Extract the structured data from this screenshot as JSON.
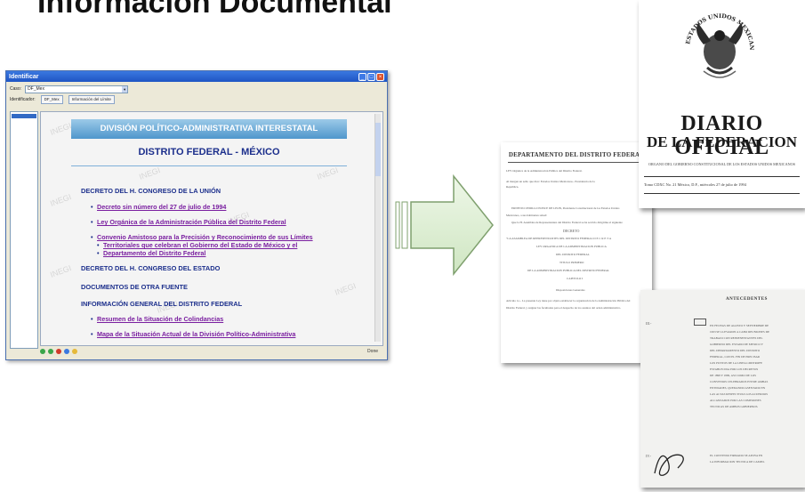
{
  "slide": {
    "title": "Información Documental"
  },
  "window": {
    "title": "Identificar",
    "caso_label": "Caso:",
    "caso_value": "DF_Mex",
    "identificador_label": "Identificador:",
    "tab1": "DF_Mex",
    "tab2": "Información del Límite",
    "status": "Done"
  },
  "page": {
    "banner_title": "DIVISIÓN POLÍTICO-ADMINISTRATIVA INTERESTATAL",
    "subtitle": "DISTRITO FEDERAL - MÉXICO",
    "sections": [
      "DECRETO DEL H. CONGRESO DE LA UNIÓN",
      "DECRETO DEL H. CONGRESO DEL ESTADO",
      "DOCUMENTOS DE OTRA FUENTE",
      "INFORMACIÓN GENERAL DEL DISTRITO FEDERAL"
    ],
    "links": [
      "Decreto sin número del 27 de julio de 1994",
      "Ley Orgánica de la Administración Pública del Distrito Federal",
      "Convenio Amistoso para la Precisión y Reconocimiento de sus Límites",
      "Territoriales que celebran el Gobierno del Estado de México y el",
      "Departamento del Distrito Federal",
      "Resumen de la Situación de Colindancias",
      "Mapa de la Situación Actual de la División Político-Administrativa"
    ],
    "watermark": "INEGI"
  },
  "docs": {
    "doc1_title": "DEPARTAMENTO DEL DISTRITO FEDERAL",
    "doc1_lines": [
      "LEY Orgánica de la Administración Pública del Distrito Federal.",
      "Al margen un sello que dice: Estados Unidos Mexicanos.- Presidencia de la",
      "República.",
      "ERNESTO ZEDILLO PONCE DE LEON, Presidente Constitucional de los Estados Unidos",
      "Mexicanos, a sus habitantes sabed:",
      "Que la H. Asamblea de Representantes del Distrito Federal se ha servido dirigirme el siguiente",
      "DECRETO",
      "\"LA ASAMBLEA DE REPRESENTANTES DEL DISTRITO FEDERAL D E C R E T A",
      "LEY ORGANICA DE LA ADMINISTRACION PUBLICA",
      "DEL DISTRITO FEDERAL",
      "TITULO PRIMERO",
      "DE LA ADMINISTRACION PUBLICA DEL DISTRITO FEDERAL",
      "CAPITULO I",
      "Disposiciones Generales",
      "Artículo 1o.- La presente Ley tiene por objeto establecer la organización de la Administración Pública del",
      "Distrito Federal, y asignar las facultades para el despacho de los asuntos del orden administrativo."
    ],
    "doc2_seal_text": "ESTADOS UNIDOS MEXICANOS",
    "doc2_title1": "DIARIO OFICIAL",
    "doc2_title2": "DE LA FEDERACION",
    "doc2_subtitle": "ORGANO DEL GOBIERNO CONSTITUCIONAL DE LOS ESTADOS UNIDOS MEXICANOS",
    "doc2_footer": "Tomo CDXC   No. 21        México, D.F., miércoles 27 de julio de 1994",
    "doc3_title": "ANTECEDENTES",
    "doc3_lines": [
      "EN FECHAS DE AGOSTO Y SEPTIEMBRE DE",
      "1993 SE LLEVARON A CABO REUNIONES DE",
      "TRABAJO CON REPRESENTANTES DEL",
      "GOBIERNO DEL ESTADO DE MEXICO Y",
      "DEL DEPARTAMENTO DEL DISTRITO",
      "FEDERAL, CON EL FIN DE PRECISAR",
      "LOS PUNTOS DE LA LINEA LIMITROFE",
      "ESTABLECIDA POR LOS DECRETOS",
      "DE 1898 Y 1899, ASI COMO DE LOS",
      "CONVENIOS CELEBRADOS ENTRE AMBAS",
      "ENTIDADES, QUEDANDO ASENTADO EN",
      "LAS ACTAS RESPECTIVAS LOS ACUERDOS",
      "ALCANZADOS POR LAS COMISIONES",
      "TECNICAS DE AMBOS GOBIERNOS.",
      "",
      "EL CONVENIO FIRMADO SE APOYA EN",
      "LA INFORMACION TECNICA DE CAMPO."
    ]
  }
}
